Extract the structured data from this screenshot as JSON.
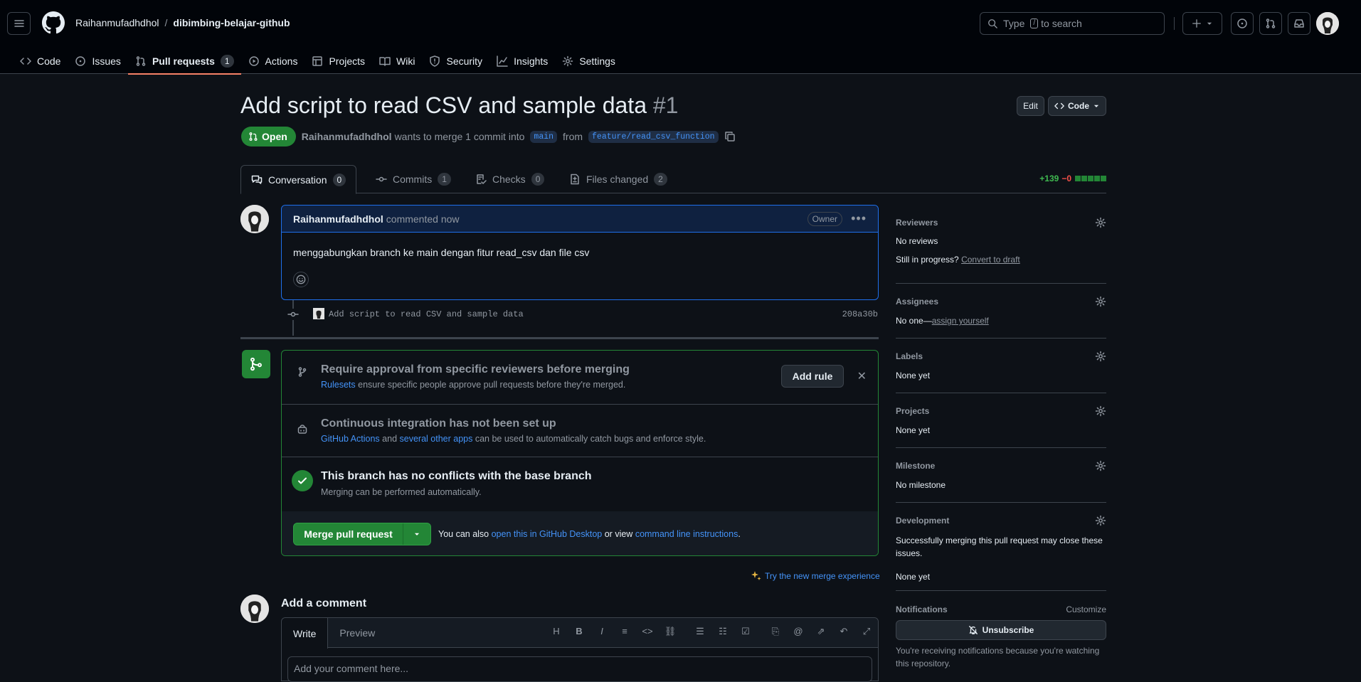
{
  "header": {
    "owner": "Raihanmufadhdhol",
    "separator": "/",
    "repo": "dibimbing-belajar-github",
    "search": {
      "prefix": "Type",
      "key": "/",
      "suffix": "to search"
    }
  },
  "repo_tabs": [
    {
      "label": "Code"
    },
    {
      "label": "Issues"
    },
    {
      "label": "Pull requests",
      "count": "1"
    },
    {
      "label": "Actions"
    },
    {
      "label": "Projects"
    },
    {
      "label": "Wiki"
    },
    {
      "label": "Security"
    },
    {
      "label": "Insights"
    },
    {
      "label": "Settings"
    }
  ],
  "pr": {
    "title": "Add script to read CSV and sample data",
    "number": "#1",
    "edit_label": "Edit",
    "code_label": "Code",
    "state": "Open",
    "author": "Raihanmufadhdhol",
    "merge_text": "wants to merge 1 commit into",
    "base": "main",
    "from_text": "from",
    "head": "feature/read_csv_function"
  },
  "pr_tabs": [
    {
      "label": "Conversation",
      "count": "0"
    },
    {
      "label": "Commits",
      "count": "1"
    },
    {
      "label": "Checks",
      "count": "0"
    },
    {
      "label": "Files changed",
      "count": "2"
    }
  ],
  "diffstat": {
    "additions": "+139",
    "deletions": "−0"
  },
  "comment": {
    "author": "Raihanmufadhdhol",
    "meta": "commented now",
    "badge": "Owner",
    "body": "menggabungkan branch ke main dengan fitur read_csv dan file csv"
  },
  "commit": {
    "message": "Add script to read CSV and sample data",
    "sha": "208a30b"
  },
  "merge": {
    "rule_title": "Require approval from specific reviewers before merging",
    "rule_link": "Rulesets",
    "rule_text": "ensure specific people approve pull requests before they're merged.",
    "add_rule": "Add rule",
    "ci_title": "Continuous integration has not been set up",
    "ci_link1": "GitHub Actions",
    "ci_and": "and",
    "ci_link2": "several other apps",
    "ci_text": "can be used to automatically catch bugs and enforce style.",
    "conflict_title": "This branch has no conflicts with the base branch",
    "conflict_text": "Merging can be performed automatically.",
    "merge_button": "Merge pull request",
    "note_prefix": "You can also",
    "note_link1": "open this in GitHub Desktop",
    "note_mid": "or view",
    "note_link2": "command line instructions",
    "note_end": ".",
    "try_new": "Try the new merge experience"
  },
  "add_comment": {
    "title": "Add a comment",
    "write_tab": "Write",
    "preview_tab": "Preview",
    "placeholder": "Add your comment here..."
  },
  "sidebar": {
    "reviewers": {
      "heading": "Reviewers",
      "value": "No reviews",
      "progress": "Still in progress?",
      "convert": "Convert to draft"
    },
    "assignees": {
      "heading": "Assignees",
      "value": "No one—",
      "link": "assign yourself"
    },
    "labels": {
      "heading": "Labels",
      "value": "None yet"
    },
    "projects": {
      "heading": "Projects",
      "value": "None yet"
    },
    "milestone": {
      "heading": "Milestone",
      "value": "No milestone"
    },
    "development": {
      "heading": "Development",
      "text": "Successfully merging this pull request may close these issues.",
      "value": "None yet"
    },
    "notifications": {
      "heading": "Notifications",
      "customize": "Customize",
      "unsubscribe": "Unsubscribe",
      "note": "You're receiving notifications because you're watching this repository."
    }
  },
  "colors": {
    "accent": "#4493f8",
    "open": "#238636",
    "tab_underline": "#f78166",
    "danger": "#f85149"
  }
}
